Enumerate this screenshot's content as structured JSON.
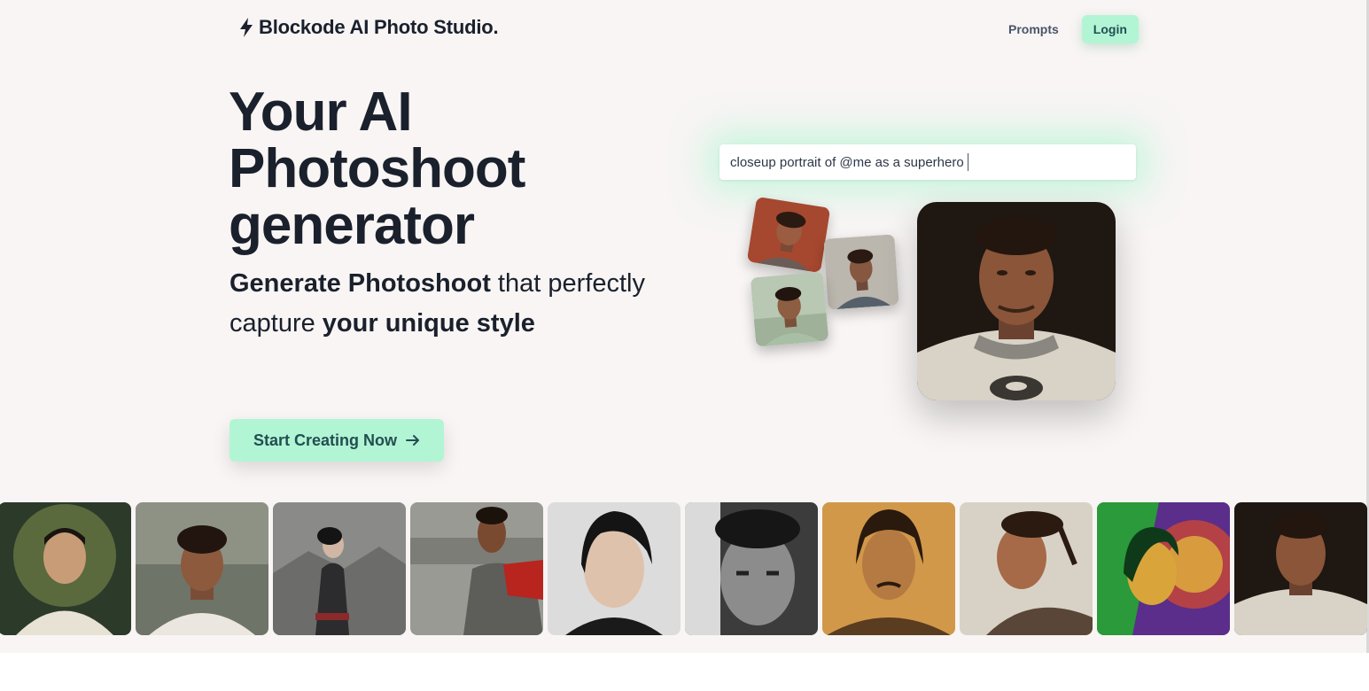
{
  "header": {
    "brand_name": "Blockode AI Photo Studio.",
    "brand_icon": "lightning-bolt-icon",
    "nav": {
      "prompts_label": "Prompts",
      "login_label": "Login"
    }
  },
  "hero": {
    "title": "Your AI Photoshoot generator",
    "subtitle_part1": "Generate Photoshoot",
    "subtitle_part2": " that perfectly capture ",
    "subtitle_part3": "your unique style",
    "cta_label": "Start Creating Now",
    "cta_icon": "arrow-right-icon"
  },
  "demo": {
    "prompt_text": "closeup portrait of @me as a superhero"
  },
  "colors": {
    "background": "#f8f5f4",
    "accent": "#b2f5d5",
    "accent_text": "#234e52",
    "text": "#1a202c"
  }
}
